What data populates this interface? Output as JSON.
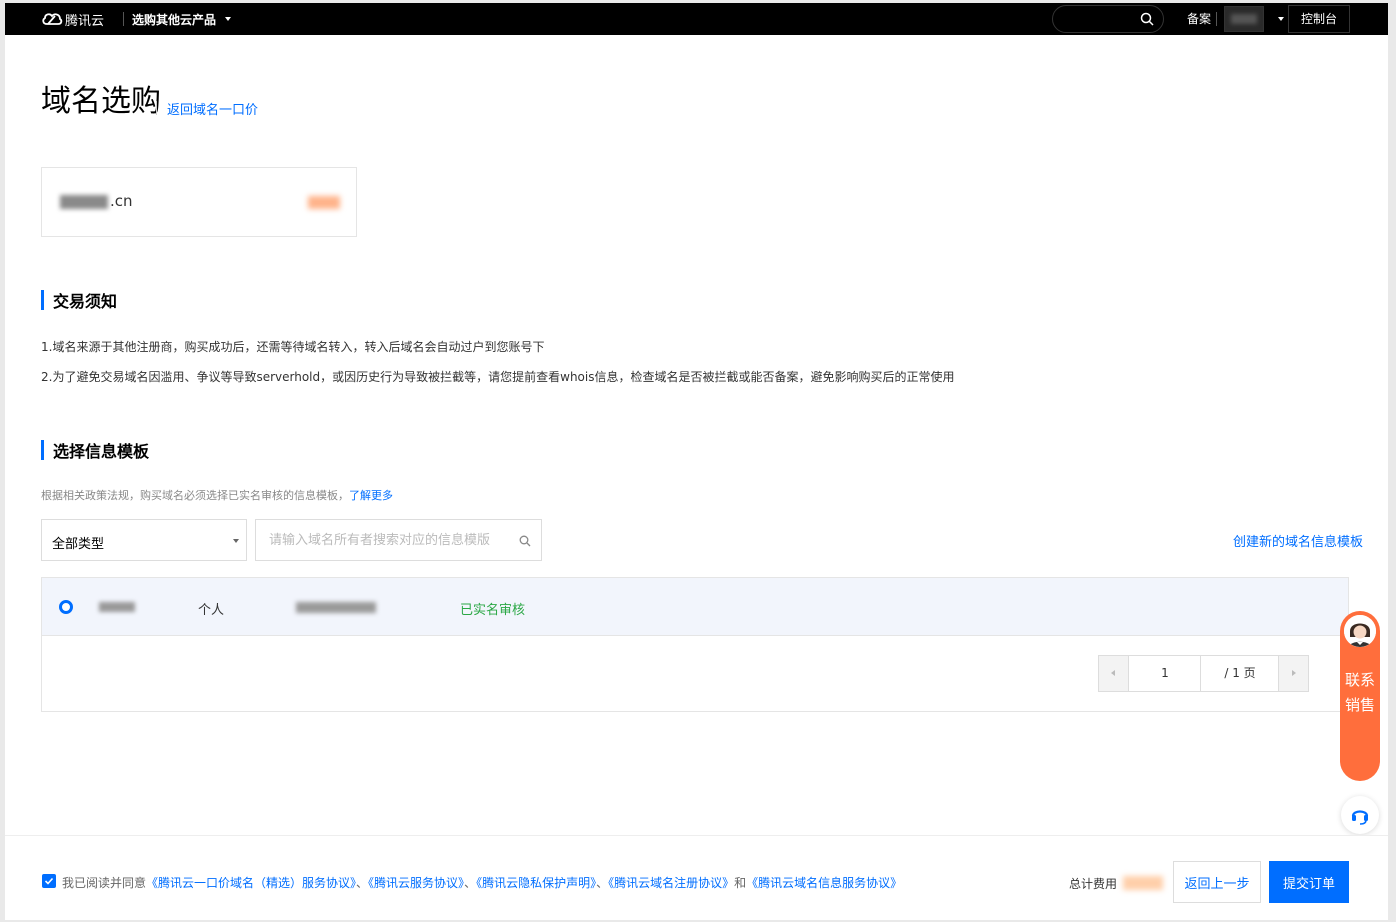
{
  "nav": {
    "brand": "腾讯云",
    "product_menu": "选购其他云产品",
    "search_placeholder": "",
    "beian": "备案",
    "console": "控制台"
  },
  "page": {
    "title": "域名选购",
    "back_link": "返回域名一口价"
  },
  "domain": {
    "tld": ".cn"
  },
  "notice": {
    "title": "交易须知",
    "items": [
      "1.域名来源于其他注册商，购买成功后，还需等待域名转入，转入后域名会自动过户到您账号下",
      "2.为了避免交易域名因滥用、争议等导致serverhold，或因历史行为导致被拦截等，请您提前查看whois信息，检查域名是否被拦截或能否备案，避免影响购买后的正常使用"
    ]
  },
  "template": {
    "title": "选择信息模板",
    "hint": "根据相关政策法规，购买域名必须选择已实名审核的信息模板，",
    "hint_link": "了解更多",
    "type_select": "全部类型",
    "search_placeholder": "请输入域名所有者搜索对应的信息模版",
    "create_link": "创建新的域名信息模板",
    "rows": [
      {
        "type": "个人",
        "status": "已实名审核"
      }
    ],
    "pager": {
      "current": "1",
      "total": "/ 1 页"
    }
  },
  "contact": {
    "text": "联系销售"
  },
  "footer": {
    "agree_prefix": "我已阅读并同意",
    "agree_links": [
      "《腾讯云一口价域名（精选）服务协议》",
      "《腾讯云服务协议》",
      "《腾讯云隐私保护声明》",
      "《腾讯云域名注册协议》",
      "《腾讯云域名信息服务协议》"
    ],
    "sep": "、",
    "and": "和",
    "total_label": "总计费用",
    "back_button": "返回上一步",
    "submit_button": "提交订单"
  },
  "colors": {
    "accent": "#006eff",
    "success": "#2ba745",
    "contact": "#ff6e3c"
  }
}
